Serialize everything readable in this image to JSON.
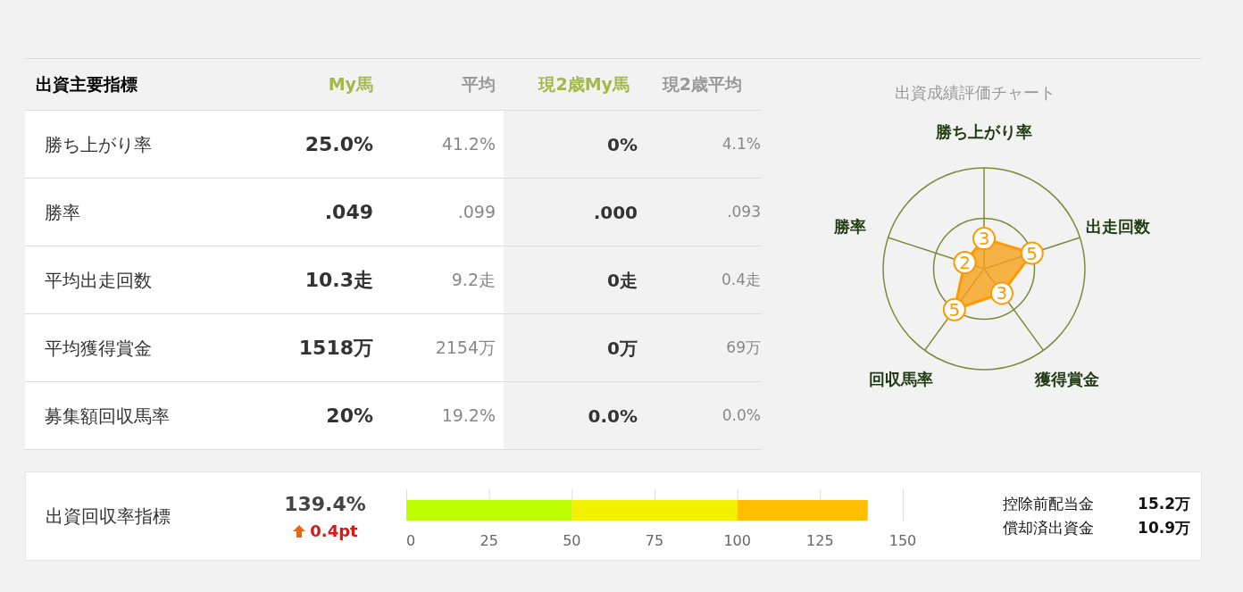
{
  "table": {
    "columns": [
      {
        "label": "出資主要指標",
        "kind": "title"
      },
      {
        "label": "My馬",
        "kind": "my"
      },
      {
        "label": "平均",
        "kind": "avg"
      },
      {
        "label": "現2歳My馬",
        "kind": "my"
      },
      {
        "label": "現2歳平均",
        "kind": "avg"
      }
    ],
    "rows": [
      {
        "cells": [
          "勝ち上がり率",
          "25.0%",
          "41.2%",
          "0%",
          "4.1%"
        ]
      },
      {
        "cells": [
          "勝率",
          ".049",
          ".099",
          ".000",
          ".093"
        ]
      },
      {
        "cells": [
          "平均出走回数",
          "10.3走",
          "9.2走",
          "0走",
          "0.4走"
        ]
      },
      {
        "cells": [
          "平均獲得賞金",
          "1518万",
          "2154万",
          "0万",
          "69万"
        ]
      },
      {
        "cells": [
          "募集額回収馬率",
          "20%",
          "19.2%",
          "0.0%",
          "0.0%"
        ]
      }
    ]
  },
  "radar": {
    "title": "出資成績評価チャート",
    "axes": [
      {
        "label": "勝ち上がり率",
        "score": "3"
      },
      {
        "label": "勝率",
        "score": "2"
      },
      {
        "label": "出走回数",
        "score": "5"
      },
      {
        "label": "回収馬率",
        "score": "5"
      },
      {
        "label": "獲得賞金",
        "score": "3"
      }
    ]
  },
  "recovery": {
    "label": "出資回収率指標",
    "value": "139.4%",
    "change": {
      "kind": "up",
      "text": "0.4pt"
    },
    "chart_data": {
      "type": "bar",
      "orientation": "horizontal",
      "stacked": true,
      "grid": true,
      "xlim": [
        0,
        150
      ],
      "xticks": [
        0,
        25,
        50,
        75,
        100,
        125,
        150
      ],
      "series": [
        {
          "color": "#bbff00",
          "values": [
            50
          ]
        },
        {
          "color": "#f2f200",
          "values": [
            50
          ]
        },
        {
          "color": "#ffbf00",
          "values": [
            39.4
          ]
        }
      ]
    },
    "stats": [
      {
        "label": "控除前配当金",
        "value": "15.2万"
      },
      {
        "label": "償却済出資金",
        "value": "10.9万"
      }
    ]
  }
}
